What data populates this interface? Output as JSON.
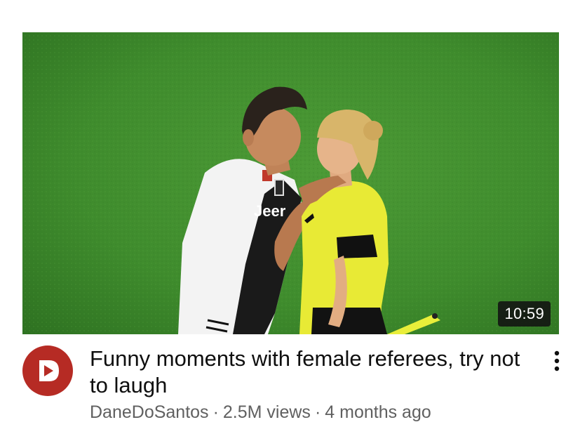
{
  "video": {
    "duration": "10:59",
    "title": "Funny moments with female referees, try not to laugh",
    "channel": "DaneDoSantos",
    "views": "2.5M views",
    "age": "4 months ago",
    "separator": "·"
  },
  "avatar": {
    "icon": "play-d-logo-icon",
    "color": "#b62b24"
  },
  "more_menu": {
    "icon": "more-vertical-icon"
  }
}
